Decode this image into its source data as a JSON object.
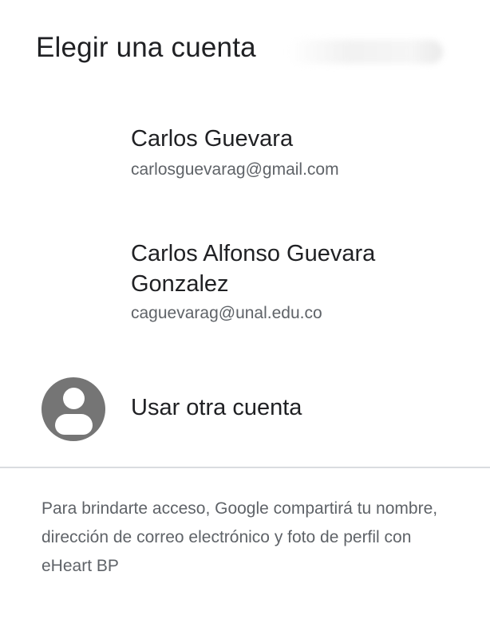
{
  "dialog": {
    "title": "Elegir una cuenta"
  },
  "accounts": [
    {
      "name": "Carlos Guevara",
      "email": "carlosguevarag@gmail.com"
    },
    {
      "name": "Carlos Alfonso Guevara Gonzalez",
      "email": "caguevarag@unal.edu.co"
    }
  ],
  "other_account": {
    "label": "Usar otra cuenta",
    "icon": "account-circle-icon"
  },
  "disclaimer": "Para brindarte acceso, Google compartirá tu nombre, dirección de correo electrónico y foto de perfil con eHeart BP",
  "colors": {
    "primary_text": "#202124",
    "secondary_text": "#5f6368",
    "avatar_bg": "#757575",
    "divider": "#dadce0"
  }
}
